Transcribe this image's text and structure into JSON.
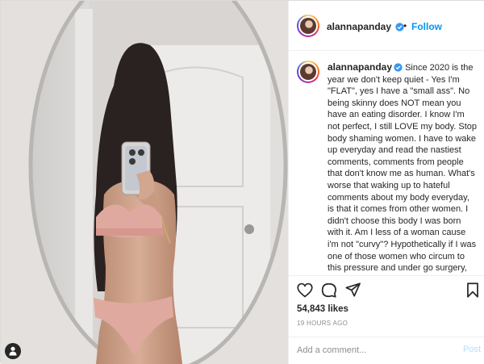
{
  "post": {
    "username": "alannapanday",
    "separator": "•",
    "follow_label": "Follow",
    "caption_text": "Since 2020 is the year we don't keep quiet - Yes I'm \"FLAT\", yes I have a \"small ass\". No being skinny does NOT mean you have an eating disorder. I know I'm not perfect, I still LOVE my body. Stop body shaming women. I have to wake up everyday and read the nastiest comments, comments from people that don't know me as human. What's worse that waking up to hateful comments about my body everyday, is that it comes from other women. I didn't choose this body I was born with it. Am I less of a woman cause i'm not \"curvy\"? Hypothetically if I was one of those women who circum to this pressure and under go surgery, I'm then \"plastic\" and \"fake\", right? Basically we'll never win with how",
    "likes": "54,843 likes",
    "timestamp": "19 HOURS AGO",
    "comment_placeholder": "Add a comment...",
    "post_label": "Post"
  },
  "icons": {
    "verified": "verified-badge-icon",
    "like": "heart-icon",
    "comment": "comment-icon",
    "share": "share-icon",
    "save": "bookmark-icon",
    "tags": "user-tag-icon"
  },
  "colors": {
    "link_blue": "#0095f6",
    "text": "#262626",
    "muted": "#8e8e8e",
    "post_disabled": "#b2dffc",
    "border": "#efefef"
  }
}
